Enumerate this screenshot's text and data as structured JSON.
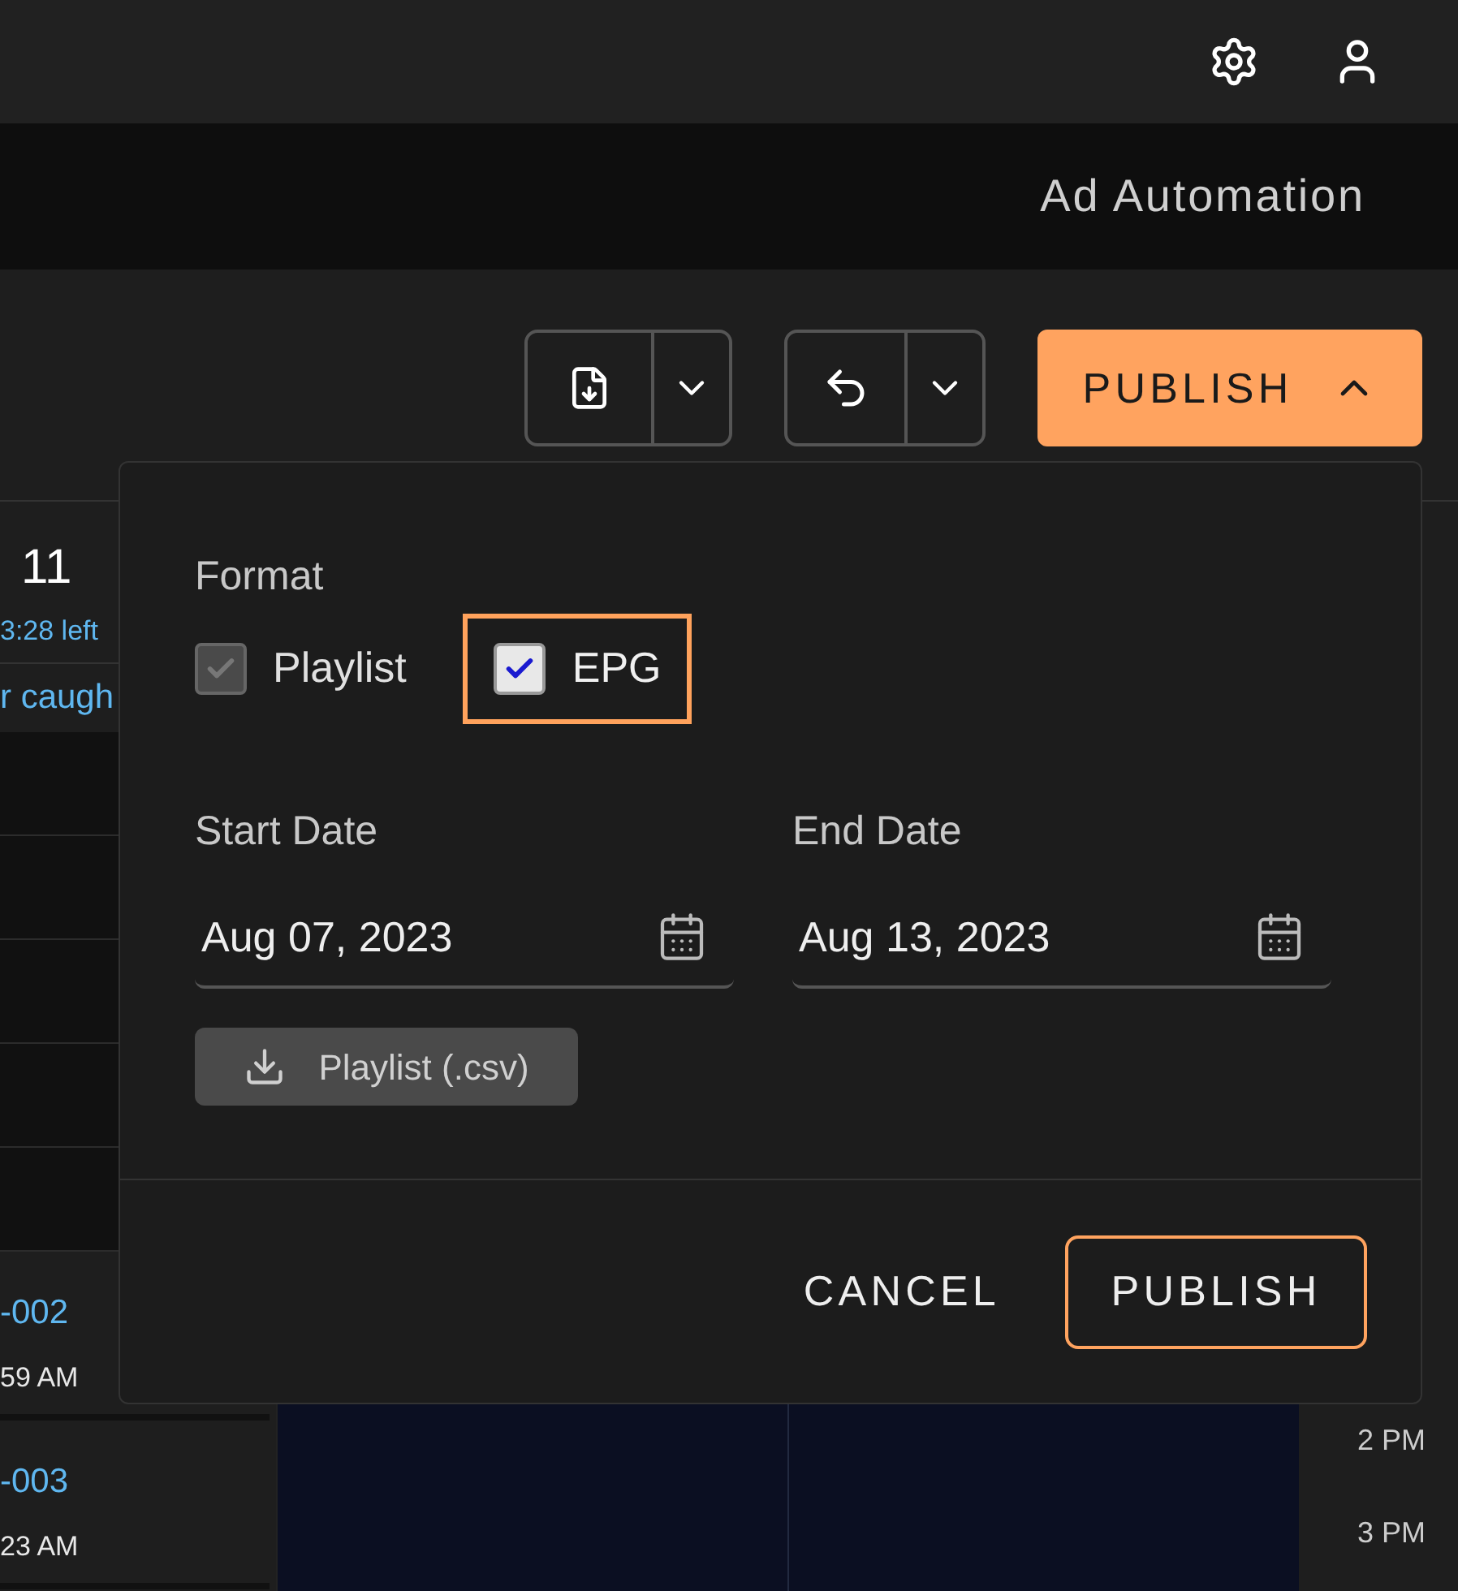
{
  "nav": {
    "title": "Ad Automation"
  },
  "toolbar": {
    "publish_button": {
      "label": "PUBLISH",
      "expanded": true
    }
  },
  "schedule": {
    "day": {
      "number": "11",
      "remaining": "3:28 left"
    },
    "note": "r caugh",
    "events": [
      {
        "id": "-002",
        "time": "59 AM"
      },
      {
        "id": "-003",
        "time": "23 AM"
      }
    ],
    "time_labels": [
      "2 PM",
      "3 PM"
    ]
  },
  "publish_dialog": {
    "format_label": "Format",
    "options": [
      {
        "label": "Playlist",
        "checked": true,
        "disabled": true,
        "focused": false
      },
      {
        "label": "EPG",
        "checked": true,
        "disabled": false,
        "focused": true
      }
    ],
    "start_date": {
      "label": "Start Date",
      "value": "Aug 07, 2023"
    },
    "end_date": {
      "label": "End Date",
      "value": "Aug 13, 2023"
    },
    "download_button": "Playlist (.csv)",
    "cancel_button": "CANCEL",
    "publish_button": "PUBLISH"
  }
}
